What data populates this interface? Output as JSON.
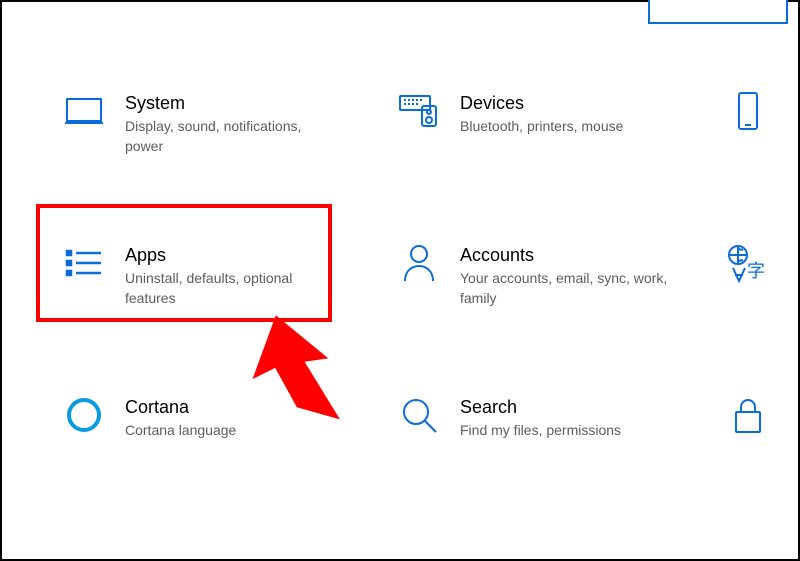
{
  "search": {
    "placeholder": ""
  },
  "tiles": {
    "system": {
      "title": "System",
      "sub": "Display, sound, notifications, power"
    },
    "devices": {
      "title": "Devices",
      "sub": "Bluetooth, printers, mouse"
    },
    "phone": {
      "title": "",
      "sub": ""
    },
    "apps": {
      "title": "Apps",
      "sub": "Uninstall, defaults, optional features"
    },
    "accounts": {
      "title": "Accounts",
      "sub": "Your accounts, email, sync, work, family"
    },
    "language": {
      "title": "",
      "sub": ""
    },
    "cortana": {
      "title": "Cortana",
      "sub": "Cortana language"
    },
    "searchTile": {
      "title": "Search",
      "sub": "Find my files, permissions"
    },
    "privacy": {
      "title": "",
      "sub": ""
    }
  },
  "colors": {
    "accent": "#0a6cd8",
    "highlight": "#ff0000"
  }
}
